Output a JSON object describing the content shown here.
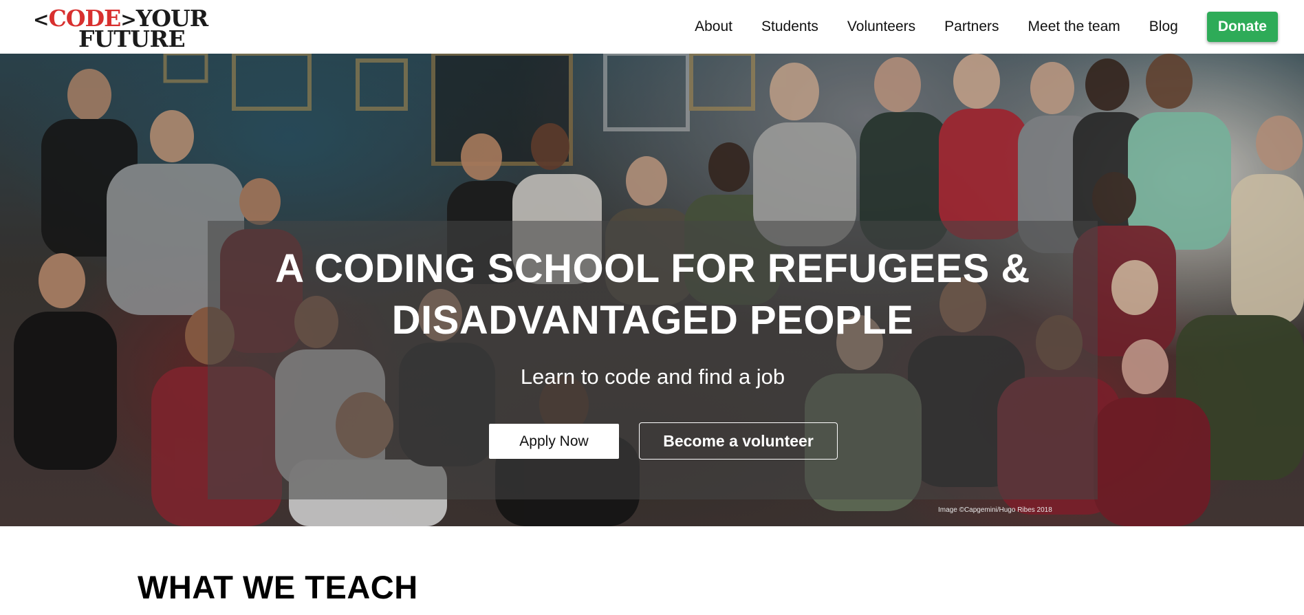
{
  "logo": {
    "open_bracket": "<",
    "code": "CODE",
    "close_bracket": ">",
    "your": "YOUR",
    "future": "FUTURE",
    "colors": {
      "code": "#d8302f",
      "text": "#1b1b1b"
    }
  },
  "nav": {
    "items": [
      {
        "label": "About"
      },
      {
        "label": "Students"
      },
      {
        "label": "Volunteers"
      },
      {
        "label": "Partners"
      },
      {
        "label": "Meet the team"
      },
      {
        "label": "Blog"
      }
    ],
    "donate_label": "Donate",
    "donate_color": "#2eab58"
  },
  "hero": {
    "title_line1": "A CODING SCHOOL FOR REFUGEES &",
    "title_line2": "DISADVANTAGED PEOPLE",
    "subtitle": "Learn to code and find a job",
    "apply_label": "Apply Now",
    "volunteer_label": "Become a volunteer",
    "photo_credit": "Image ©Capgemini/Hugo Ribes 2018"
  },
  "sections": {
    "what_we_teach_heading": "WHAT WE TEACH"
  }
}
